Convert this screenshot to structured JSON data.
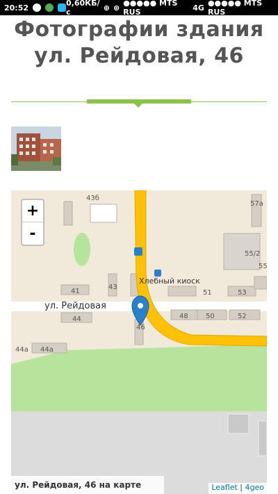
{
  "status": {
    "time": "20:52",
    "speed": "0,60КБ/с",
    "carrier1": "●●●●● MTS RUS",
    "network": "4G",
    "carrier2": "●●●●● MTS RUS"
  },
  "page": {
    "title_line1": "Фотографии здания",
    "title_line2": "ул. Рейдовая, 46"
  },
  "map": {
    "zoom_in": "+",
    "zoom_out": "-",
    "street_label": "ул. Рейдовая",
    "kiosk_label": "Хлебный киоск",
    "house_numbers": [
      "43б",
      "57а",
      "55/2",
      "55",
      "41",
      "43",
      "51",
      "53",
      "44",
      "48",
      "50",
      "52",
      "44а",
      "44а",
      "46"
    ],
    "caption": "ул. Рейдовая, 46 на карте",
    "attribution_leaflet": "Leaflet",
    "attribution_sep": " | ",
    "attribution_4geo": "4geo",
    "colors": {
      "road": "#ffc107",
      "park": "#b7e19a",
      "water_gray": "#d9d9d9",
      "marker": "#2a81cb"
    }
  }
}
